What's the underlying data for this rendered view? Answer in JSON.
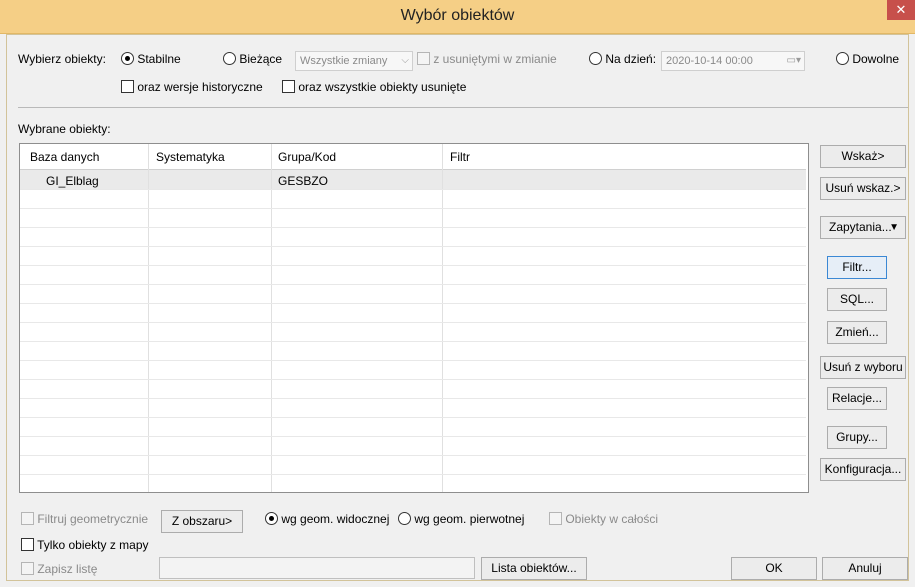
{
  "window": {
    "title": "Wybór obiektów",
    "close_glyph": "✕"
  },
  "select": {
    "label": "Wybierz obiekty:",
    "stable": "Stabilne",
    "current": "Bieżące",
    "changes_combo": "Wszystkie zmiany",
    "with_deleted": "z usuniętymi w zmianie",
    "on_date": "Na dzień:",
    "date_value": "2020-10-14 00:00",
    "any": "Dowolne",
    "historical": "oraz wersje historyczne",
    "all_deleted": "oraz wszystkie obiekty usunięte"
  },
  "selected": {
    "label": "Wybrane obiekty:",
    "columns": [
      "Baza danych",
      "Systematyka",
      "Grupa/Kod",
      "Filtr"
    ],
    "rows": [
      {
        "db": "GI_Elblag",
        "systematics": "",
        "group": "GESBZO",
        "filter": ""
      }
    ]
  },
  "side_buttons": {
    "point": "Wskaż>",
    "remove_point": "Usuń wskaz.>",
    "queries": "Zapytania...",
    "filter": "Filtr...",
    "sql": "SQL...",
    "change": "Zmień...",
    "remove_selection": "Usuń z wyboru",
    "relations": "Relacje...",
    "groups": "Grupy...",
    "config": "Konfiguracja..."
  },
  "bottom": {
    "geom_filter": "Filtruj geometrycznie",
    "from_area": "Z obszaru>",
    "visible_geom": "wg geom. widocznej",
    "original_geom": "wg geom. pierwotnej",
    "whole_objects": "Obiekty w całości",
    "map_only": "Tylko obiekty z mapy",
    "save_list": "Zapisz listę",
    "object_list": "Lista obiektów...",
    "ok": "OK",
    "cancel": "Anuluj"
  }
}
